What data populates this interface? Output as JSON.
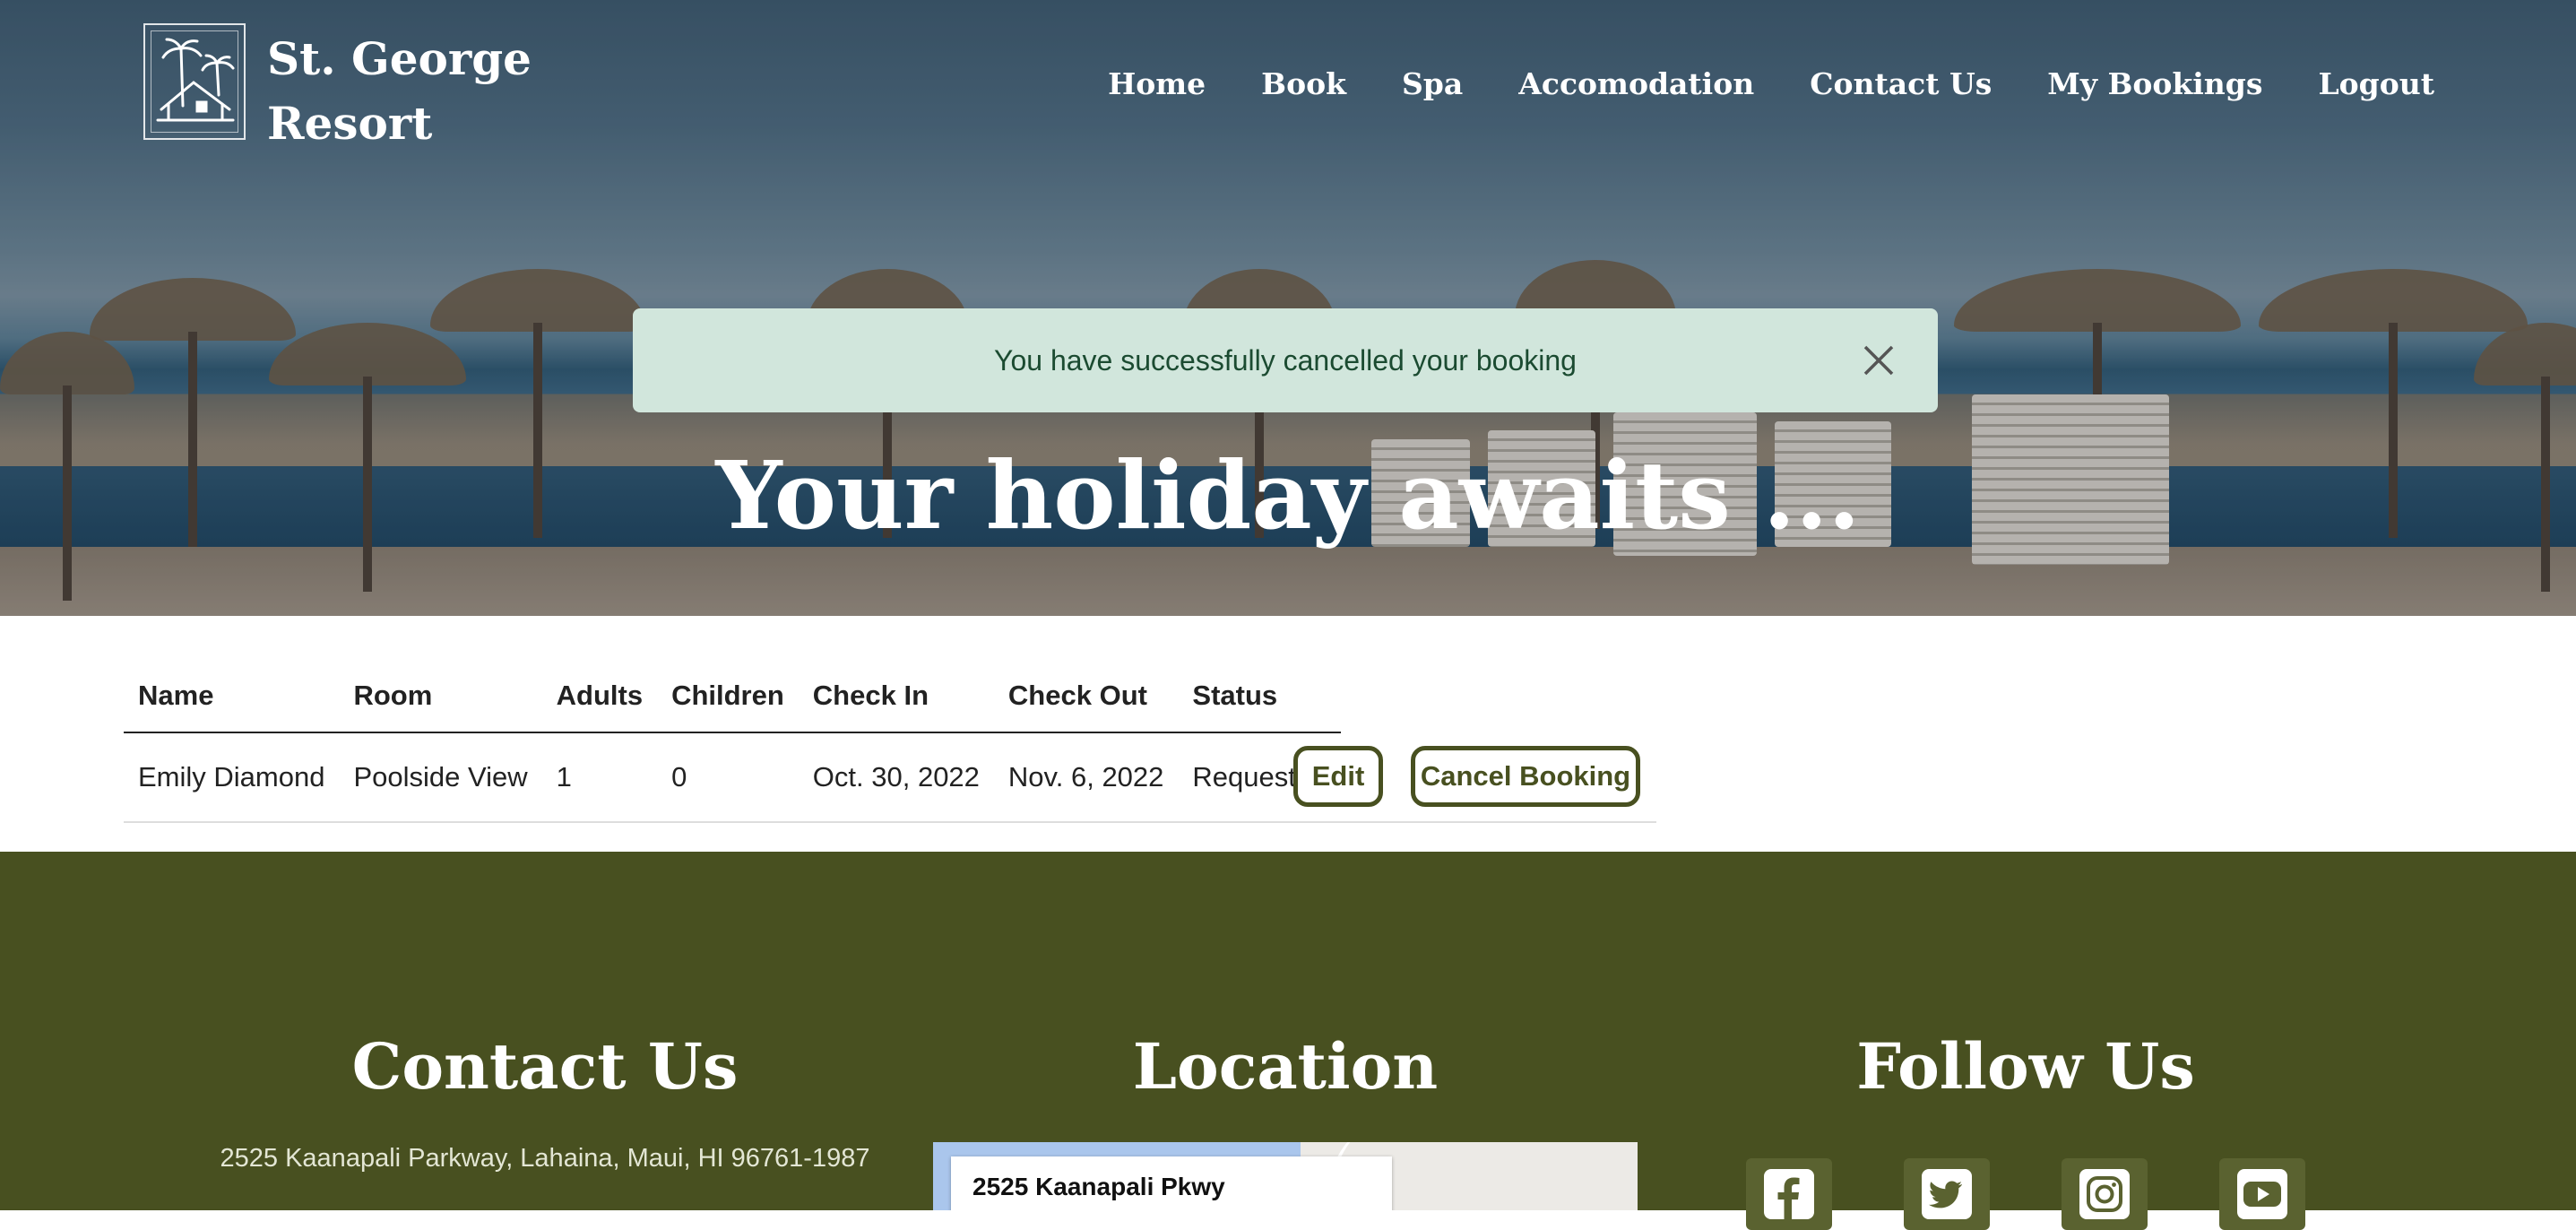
{
  "brand": {
    "line1": "St. George",
    "line2": "Resort"
  },
  "nav": {
    "items": [
      "Home",
      "Book",
      "Spa",
      "Accomodation",
      "Contact Us",
      "My Bookings",
      "Logout"
    ]
  },
  "alert": {
    "message": "You have successfully cancelled your booking"
  },
  "hero": {
    "title": "Your holiday awaits ..."
  },
  "bookings": {
    "headers": [
      "Name",
      "Room",
      "Adults",
      "Children",
      "Check In",
      "Check Out",
      "Status"
    ],
    "rows": [
      {
        "name": "Emily Diamond",
        "room": "Poolside View",
        "adults": "1",
        "children": "0",
        "check_in": "Oct. 30, 2022",
        "check_out": "Nov. 6, 2022",
        "status": "Requested"
      }
    ],
    "edit_label": "Edit",
    "cancel_label": "Cancel Booking"
  },
  "footer": {
    "contact_title": "Contact Us",
    "address": "2525 Kaanapali Parkway, Lahaina, Maui, HI 96761-1987",
    "location_title": "Location",
    "map_card_title": "2525 Kaanapali Pkwy",
    "map_label_fragment": "ali",
    "follow_title": "Follow Us",
    "social": [
      "facebook-icon",
      "twitter-icon",
      "instagram-icon",
      "youtube-icon"
    ]
  },
  "colors": {
    "brand_green": "#485020",
    "alert_bg": "#d1e6dc",
    "alert_text": "#1b4b31"
  }
}
